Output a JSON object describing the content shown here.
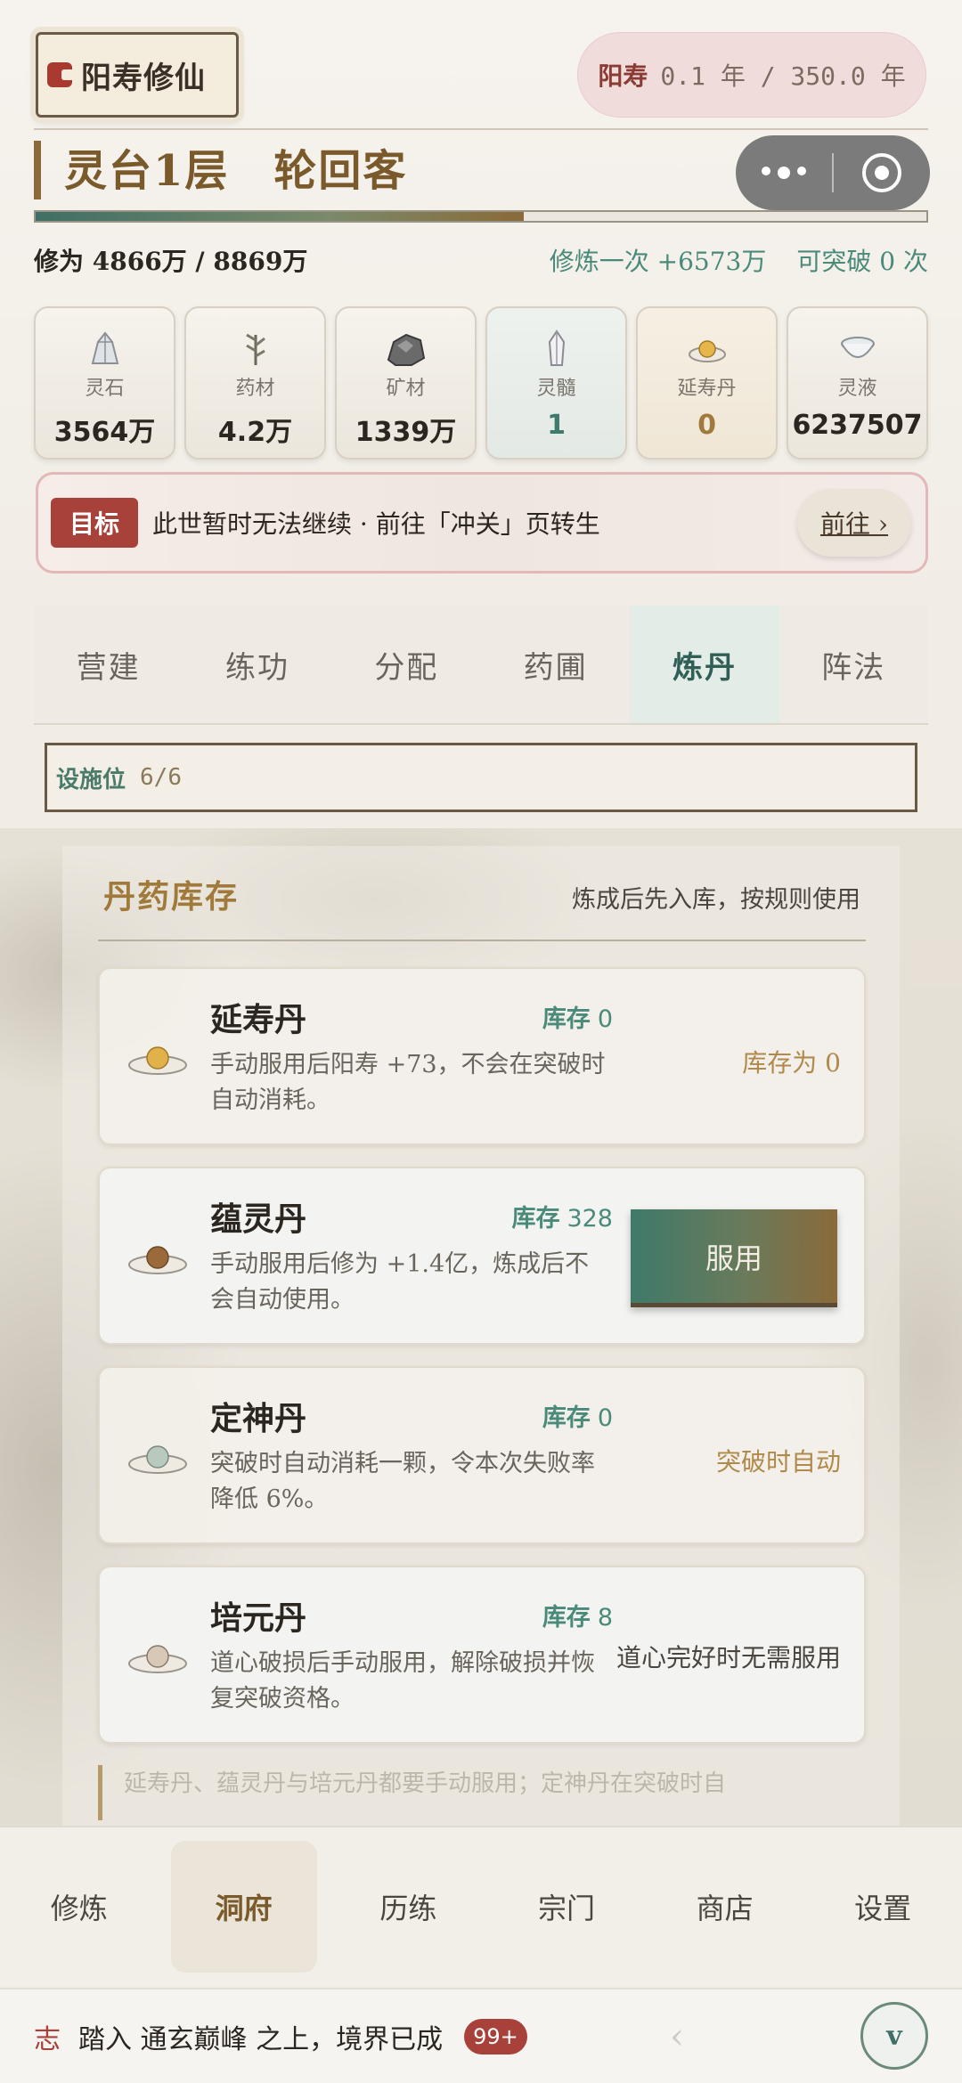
{
  "app": {
    "logo_text": "阳寿修仙"
  },
  "lifespan": {
    "label": "阳寿",
    "value": "0.1 年 / 350.0 年"
  },
  "realm": {
    "title": "灵台1层　轮回客"
  },
  "progress": {
    "fraction": 0.548
  },
  "cultivation": {
    "left": "修为 4866万 / 8869万",
    "per_cultivate": "修炼一次 +6573万",
    "breakthrough": "可突破 0 次"
  },
  "resources": [
    {
      "label": "灵石",
      "value": "3564万",
      "icon": "spirit-stone-icon"
    },
    {
      "label": "药材",
      "value": "4.2万",
      "icon": "herb-icon"
    },
    {
      "label": "矿材",
      "value": "1339万",
      "icon": "ore-icon"
    },
    {
      "label": "灵髓",
      "value": "1",
      "icon": "crystal-icon"
    },
    {
      "label": "延寿丹",
      "value": "0",
      "icon": "pill-icon"
    },
    {
      "label": "灵液",
      "value": "6237507",
      "icon": "bowl-icon"
    }
  ],
  "goal": {
    "tag": "目标",
    "text": "此世暂时无法继续 · 前往「冲关」页转生",
    "button": "前往 ›"
  },
  "tabs": [
    {
      "label": "营建"
    },
    {
      "label": "练功"
    },
    {
      "label": "分配"
    },
    {
      "label": "药圃"
    },
    {
      "label": "炼丹",
      "active": true
    },
    {
      "label": "阵法"
    }
  ],
  "facility": {
    "label": "设施位",
    "count": "6/6"
  },
  "storage": {
    "title": "丹药库存",
    "subtitle": "炼成后先入库，按规则使用",
    "stock_label": "库存",
    "pills": [
      {
        "name": "延寿丹",
        "stock": "0",
        "desc": "手动服用后阳寿 +73，不会在突破时自动消耗。",
        "side": "库存为 0"
      },
      {
        "name": "蕴灵丹",
        "stock": "328",
        "desc": "手动服用后修为 +1.4亿，炼成后不会自动使用。",
        "button": "服用"
      },
      {
        "name": "定神丹",
        "stock": "0",
        "desc": "突破时自动消耗一颗，令本次失败率降低 6%。",
        "side": "突破时自动"
      },
      {
        "name": "培元丹",
        "stock": "8",
        "desc": "道心破损后手动服用，解除破损并恢复突破资格。",
        "side": "道心完好时无需服用"
      }
    ],
    "footnote": "延寿丹、蕴灵丹与培元丹都要手动服用；定神丹在突破时自"
  },
  "bottom_nav": [
    {
      "label": "修炼"
    },
    {
      "label": "洞府",
      "active": true
    },
    {
      "label": "历练"
    },
    {
      "label": "宗门"
    },
    {
      "label": "商店"
    },
    {
      "label": "设置"
    }
  ],
  "ticker": {
    "prefix": "志",
    "text": "踏入 通玄巅峰 之上，境界已成",
    "badge": "99+",
    "collapse": "v"
  }
}
